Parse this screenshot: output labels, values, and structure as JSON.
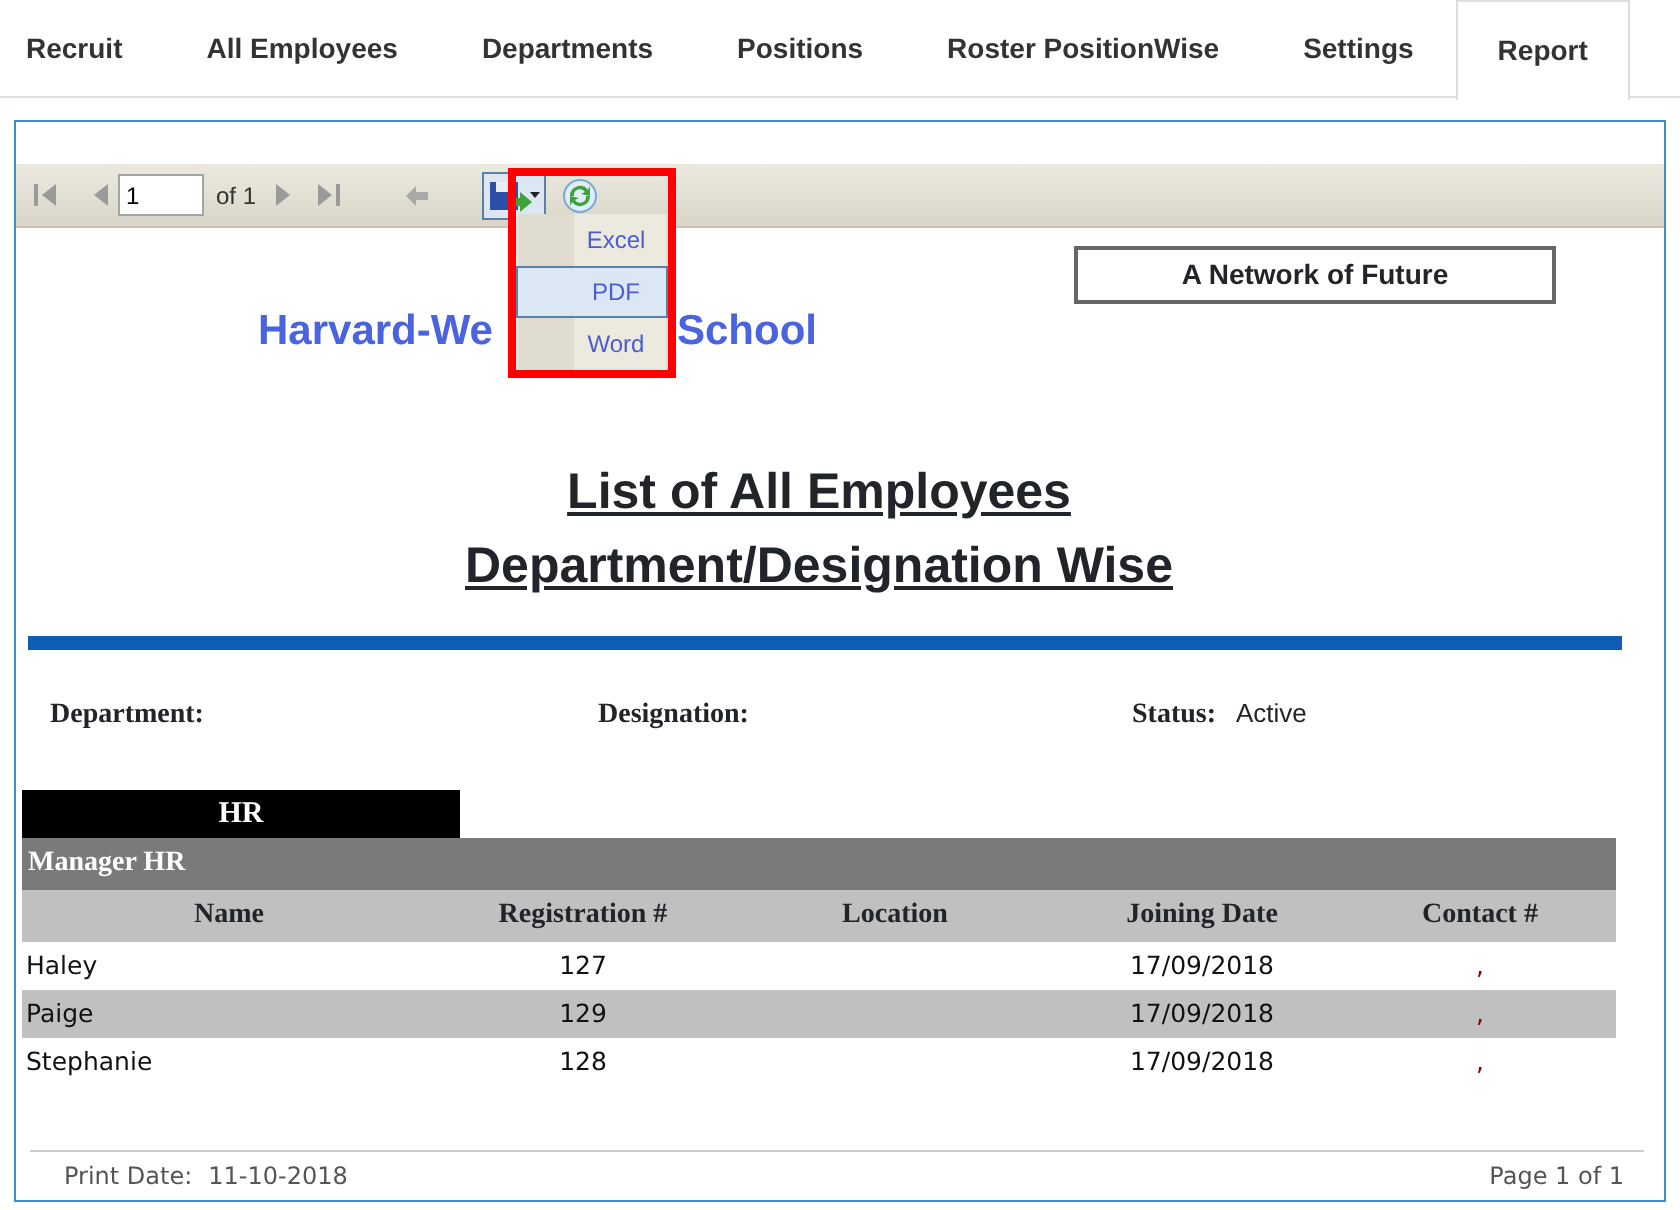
{
  "tabs": [
    {
      "label": "Recruit",
      "selected": false
    },
    {
      "label": "All Employees",
      "selected": false
    },
    {
      "label": "Departments",
      "selected": false
    },
    {
      "label": "Positions",
      "selected": false
    },
    {
      "label": "Roster PositionWise",
      "selected": false
    },
    {
      "label": "Settings",
      "selected": false
    },
    {
      "label": "Report",
      "selected": true
    }
  ],
  "toolbar": {
    "page": "1",
    "page_of": "of 1",
    "export_menu": {
      "expanded": true,
      "highlighted": true,
      "items": [
        {
          "label": "Excel",
          "selected": false
        },
        {
          "label": "PDF",
          "selected": true
        },
        {
          "label": "Word",
          "selected": false
        }
      ]
    }
  },
  "report": {
    "tagline": "A Network of Future",
    "school_name_parts": [
      "Harvard-We",
      "School"
    ],
    "title_lines": [
      "List of All Employees",
      "Department/Designation Wise"
    ],
    "filters": [
      {
        "label": "Department:"
      },
      {
        "label": "Designation:"
      },
      {
        "label": "Status:",
        "value": "Active"
      }
    ],
    "department": "HR",
    "group": "Manager HR",
    "columns": [
      "Name",
      "Registration #",
      "Location",
      "Joining Date",
      "Contact #"
    ],
    "rows": [
      [
        "Haley",
        "127",
        "",
        "17/09/2018",
        ","
      ],
      [
        "Paige",
        "129",
        "",
        "17/09/2018",
        ","
      ],
      [
        "Stephanie",
        "128",
        "",
        "17/09/2018",
        ","
      ]
    ],
    "footer": {
      "print_date_label": "Print Date:",
      "print_date": "11-10-2018",
      "page": "Page 1 of 1"
    }
  }
}
